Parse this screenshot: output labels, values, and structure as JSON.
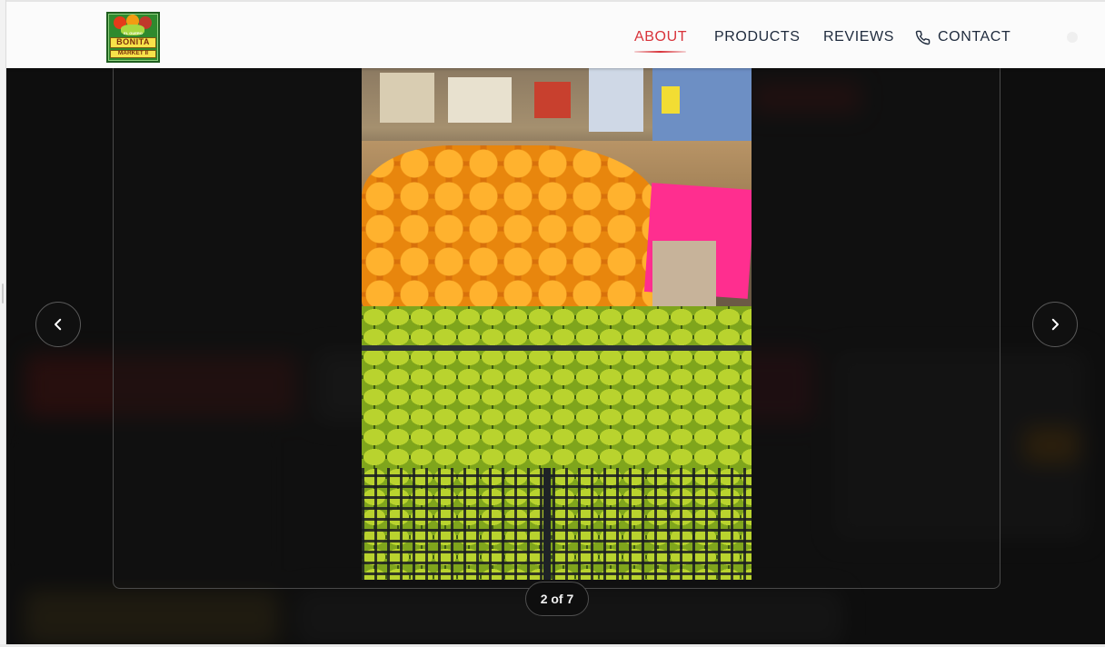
{
  "header": {
    "logo_lines": {
      "top": "BONITA",
      "bottom": "MARKET II",
      "tiny": "EL GUERO"
    },
    "nav": [
      {
        "label": "ABOUT",
        "active": true
      },
      {
        "label": "PRODUCTS",
        "active": false
      },
      {
        "label": "REVIEWS",
        "active": false
      },
      {
        "label": "CONTACT",
        "active": false,
        "icon": "phone-icon"
      }
    ],
    "colors": {
      "active": "#d8333a",
      "link": "#1f2b3d"
    }
  },
  "lightbox": {
    "counter": "2 of 7",
    "prev_icon": "chevron-left-icon",
    "next_icon": "chevron-right-icon",
    "photo_subject": "produce-display-photo"
  }
}
